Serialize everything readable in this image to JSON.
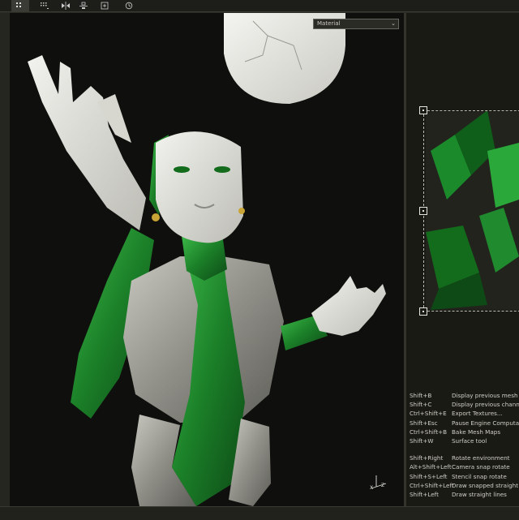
{
  "toolbar": {
    "buttons": [
      {
        "icon": "grid-icon",
        "active": true
      },
      {
        "icon": "dotted-grid-icon",
        "active": false
      },
      {
        "icon": "mirror-icon",
        "active": false
      },
      {
        "icon": "align-icon",
        "active": false
      },
      {
        "icon": "add-frame-icon",
        "active": false
      },
      {
        "icon": "timer-icon",
        "active": false
      }
    ]
  },
  "viewport": {
    "channel_dropdown": "Material"
  },
  "shortcuts": {
    "group1": [
      {
        "key": "Shift+B",
        "desc": "Display previous mesh map"
      },
      {
        "key": "Shift+C",
        "desc": "Display previous channel"
      },
      {
        "key": "Ctrl+Shift+E",
        "desc": "Export Textures..."
      },
      {
        "key": "Shift+Esc",
        "desc": "Pause Engine Computation"
      },
      {
        "key": "Ctrl+Shift+B",
        "desc": "Bake Mesh Maps"
      },
      {
        "key": "Shift+W",
        "desc": "Surface tool"
      }
    ],
    "group2": [
      {
        "key": "Shift+Right",
        "desc": "Rotate environment"
      },
      {
        "key": "Alt+Shift+Left",
        "desc": "Camera snap rotate"
      },
      {
        "key": "Shift+S+Left",
        "desc": "Stencil snap rotate"
      },
      {
        "key": "Ctrl+Shift+Left",
        "desc": "Draw snapped straight lines"
      },
      {
        "key": "Shift+Left",
        "desc": "Draw straight lines"
      }
    ]
  },
  "axis": {
    "x": "X",
    "z": "Z"
  },
  "colors": {
    "emerald": "#1f8a2e",
    "stone": "#9a9a92",
    "bg": "#0f0f0d"
  }
}
